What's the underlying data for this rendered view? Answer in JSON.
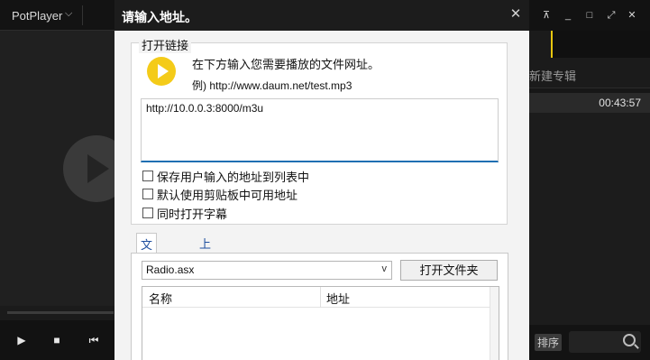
{
  "player": {
    "brand": "PotPlayer",
    "brand_caret": "⌵",
    "new_album": "新建专辑",
    "time": "00:43:57",
    "sort_label": "排序",
    "window_buttons": [
      "pin",
      "minimize",
      "maximize",
      "fullscreen",
      "close"
    ]
  },
  "dialog": {
    "title": "请输入地址。",
    "close_glyph": "✕",
    "group_label": "打开链接",
    "description": "在下方输入您需要播放的文件网址。",
    "example": "例) http://www.daum.net/test.mp3",
    "url_value": "http://10.0.0.3:8000/m3u",
    "checkboxes": [
      {
        "label": "保存用户输入的地址到列表中",
        "checked": false
      },
      {
        "label": "默认使用剪贴板中可用地址",
        "checked": false
      },
      {
        "label": "同时打开字幕",
        "checked": false
      }
    ],
    "tabs": [
      {
        "label": "文件地址",
        "active": true
      },
      {
        "label": "上一地址",
        "active": false
      }
    ],
    "select_value": "Radio.asx",
    "select_caret": "v",
    "open_folder_button": "打开文件夹",
    "table_headers": [
      "名称",
      "地址"
    ]
  },
  "colors": {
    "accent_yellow": "#f4cb19",
    "link_blue": "#1f4f9f",
    "focus_blue": "#1f6fb2",
    "title_bar": "#1c1c1c"
  }
}
